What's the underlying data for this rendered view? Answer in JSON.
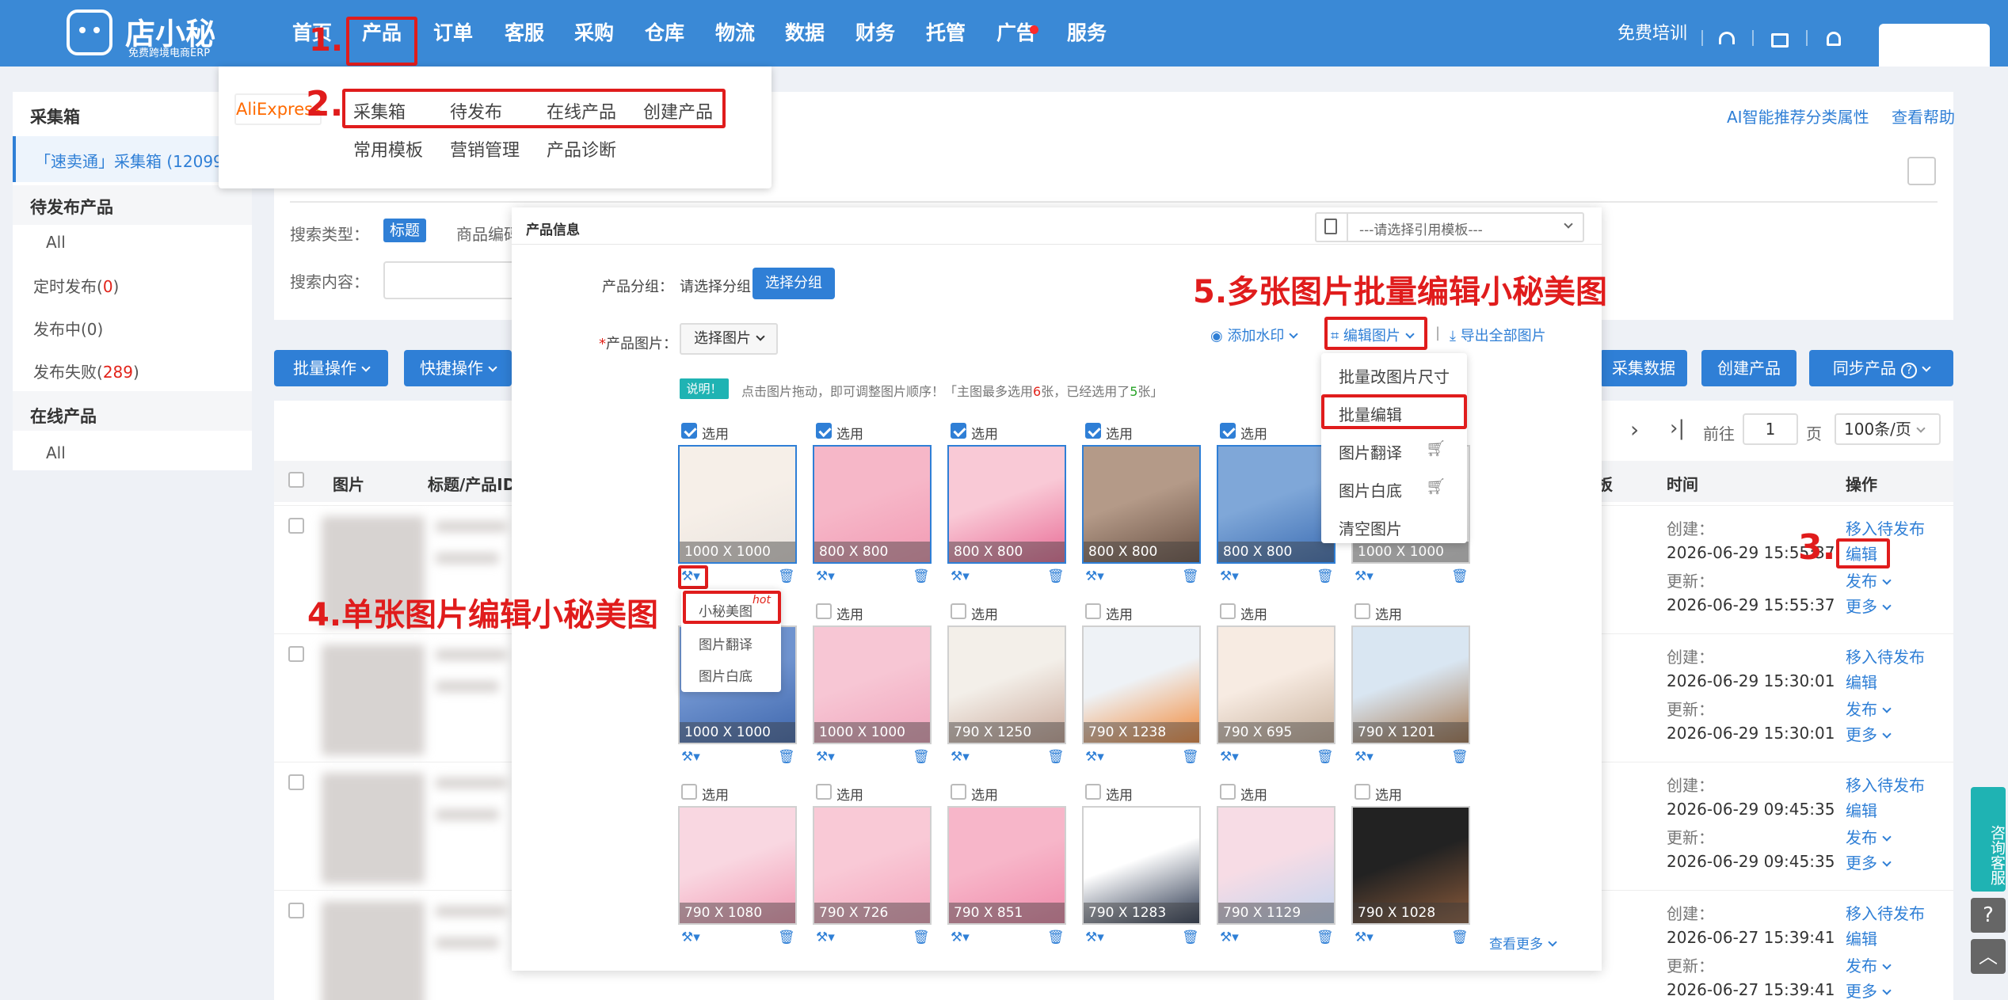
{
  "app": {
    "logo_title": "店小秘",
    "logo_sub": "免费跨境电商ERP"
  },
  "nav": [
    "首页",
    "产品",
    "订单",
    "客服",
    "采购",
    "仓库",
    "物流",
    "数据",
    "财务",
    "托管",
    "广告",
    "服务"
  ],
  "topright": {
    "training": "免费培训"
  },
  "colors": {
    "primary": "#3a89d6",
    "button": "#2f7fd6",
    "annotation": "#e01c1c",
    "tag": "#1fb3b3"
  },
  "steps": [
    "1.",
    "2.",
    "3."
  ],
  "annotations": {
    "a4": "4.单张图片编辑小秘美图",
    "a5": "5.多张图片批量编辑小秘美图"
  },
  "dropdown": {
    "brand": "AliExpress",
    "row1": [
      "采集箱",
      "待发布",
      "在线产品",
      "创建产品"
    ],
    "row2": [
      "常用模板",
      "营销管理",
      "产品诊断"
    ]
  },
  "sidebar": {
    "h1": "采集箱",
    "item1": "「速卖通」采集箱 (12099)",
    "h2": "待发布产品",
    "all": "All",
    "sched": "定时发布(",
    "sched_n": "0",
    "close": ")",
    "publishing": "发布中(0)",
    "failed": "发布失败(",
    "failed_n": "289",
    "h3": "在线产品",
    "all2": "All"
  },
  "header_links": {
    "ai": "AI智能推荐分类属性",
    "help": "查看帮助"
  },
  "search": {
    "type_label": "搜索类型：",
    "type_active": "标题",
    "type_other": "商品编码",
    "content_label": "搜索内容："
  },
  "toolbar": {
    "batch": "批量操作",
    "quick": "快捷操作",
    "collect": "采集数据",
    "create": "创建产品",
    "sync": "同步产品"
  },
  "pagination": {
    "goto": "前往",
    "page": "1",
    "page_unit": "页",
    "per": "100条/页"
  },
  "table": {
    "img": "图片",
    "title": "标题/产品ID",
    "ban": "板",
    "time": "时间",
    "op": "操作"
  },
  "rows": [
    {
      "created_l": "创建：",
      "created": "2026-06-29 15:55:37",
      "updated_l": "更新：",
      "updated": "2026-06-29 15:55:37"
    },
    {
      "created_l": "创建：",
      "created": "2026-06-29 15:30:01",
      "updated_l": "更新：",
      "updated": "2026-06-29 15:30:01"
    },
    {
      "created_l": "创建：",
      "created": "2026-06-29 09:45:35",
      "updated_l": "更新：",
      "updated": "2026-06-29 09:45:35"
    },
    {
      "created_l": "创建：",
      "created": "2026-06-27 15:39:41",
      "updated_l": "更新：",
      "updated": "2026-06-27 15:39:41"
    }
  ],
  "ops": {
    "move": "移入待发布",
    "edit": "编辑",
    "publish": "发布",
    "more": "更多"
  },
  "modal": {
    "title": "产品信息",
    "template": "---请选择引用模板---",
    "group_label": "产品分组：",
    "group_hint": "请选择分组",
    "group_btn": "选择分组",
    "img_req": "*",
    "img_label": "产品图片：",
    "img_select": "选择图片",
    "watermark": "添加水印",
    "edit_img": "编辑图片",
    "export": "导出全部图片",
    "tip_tag": "说明！",
    "tip_a": "点击图片拖动，即可调整图片顺序！「主图最多选用",
    "tip_6": "6",
    "tip_b": "张，已经选用了",
    "tip_5": "5",
    "tip_c": "张」",
    "sel": "选用",
    "more": "查看更多"
  },
  "images": [
    {
      "dim": "1000 X 1000",
      "checked": true
    },
    {
      "dim": "800 X 800",
      "checked": true
    },
    {
      "dim": "800 X 800",
      "checked": true
    },
    {
      "dim": "800 X 800",
      "checked": true
    },
    {
      "dim": "800 X 800",
      "checked": true
    },
    {
      "dim": "1000 X 1000",
      "checked": false
    },
    {
      "dim": "1000 X 1000",
      "checked": false
    },
    {
      "dim": "1000 X 1000",
      "checked": false
    },
    {
      "dim": "790 X 1250",
      "checked": false
    },
    {
      "dim": "790 X 1238",
      "checked": false
    },
    {
      "dim": "790 X 695",
      "checked": false
    },
    {
      "dim": "790 X 1201",
      "checked": false
    },
    {
      "dim": "790 X 1080",
      "checked": false
    },
    {
      "dim": "790 X 726",
      "checked": false
    },
    {
      "dim": "790 X 851",
      "checked": false
    },
    {
      "dim": "790 X 1283",
      "checked": false
    },
    {
      "dim": "790 X 1129",
      "checked": false
    },
    {
      "dim": "790 X 1028",
      "checked": false
    }
  ],
  "edit_menu": [
    "批量改图片尺寸",
    "批量编辑",
    "图片翻译",
    "图片白底",
    "清空图片"
  ],
  "single_menu": {
    "meitu": "小秘美图",
    "hot": "hot",
    "translate": "图片翻译",
    "white": "图片白底"
  },
  "float": {
    "consult": "咨询客服"
  }
}
